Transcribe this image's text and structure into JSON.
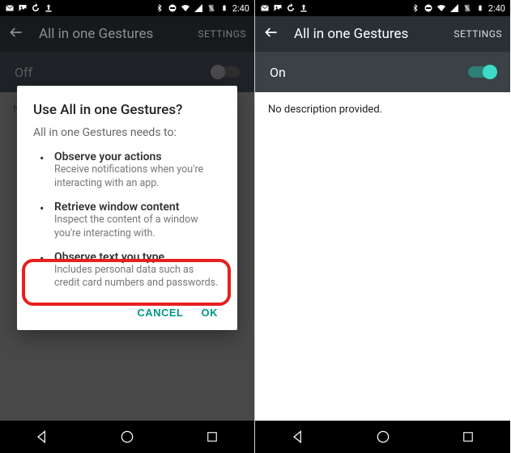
{
  "status": {
    "time": "2:40"
  },
  "left": {
    "title": "All in one Gestures",
    "settings": "SETTINGS",
    "toggle_label": "Off",
    "body_peek": "N",
    "dialog": {
      "title": "Use All in one Gestures?",
      "subtitle": "All in one Gestures needs to:",
      "perms": [
        {
          "title": "Observe your actions",
          "desc": "Receive notifications when you're interacting with an app."
        },
        {
          "title": "Retrieve window content",
          "desc": "Inspect the content of a window you're interacting with."
        },
        {
          "title": "Observe text you type",
          "desc": "Includes personal data such as credit card numbers and passwords."
        }
      ],
      "cancel": "CANCEL",
      "ok": "OK"
    }
  },
  "right": {
    "title": "All in one Gestures",
    "settings": "SETTINGS",
    "toggle_label": "On",
    "body_text": "No description provided."
  }
}
